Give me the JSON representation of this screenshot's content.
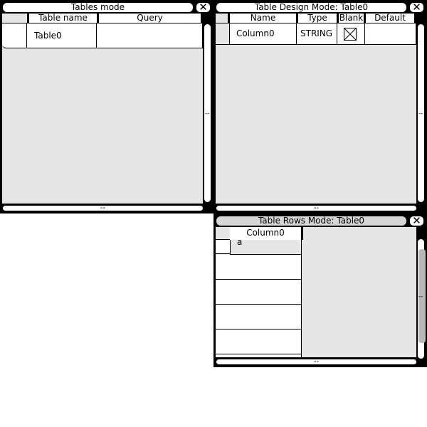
{
  "tables_window": {
    "title": "Tables mode",
    "close_label": "✕",
    "headers": {
      "name": "Table name",
      "query": "Query"
    },
    "rows": [
      {
        "name": "Table0",
        "query": ""
      }
    ],
    "hscroll_label": "--",
    "vscroll_grip": "--"
  },
  "design_window": {
    "title": "Table Design Mode: Table0",
    "close_label": "✕",
    "headers": {
      "name": "Name",
      "type": "Type",
      "blank": "Blank",
      "default": "Default"
    },
    "rows": [
      {
        "name": "Column0",
        "type": "STRING",
        "blank": true,
        "default": ""
      }
    ],
    "hscroll_label": "--",
    "vscroll_grip": "--"
  },
  "rows_window": {
    "title": "Table Rows Mode: Table0",
    "close_label": "✕",
    "headers": {
      "column0": "Column0"
    },
    "rows": [
      {
        "column0": "a"
      },
      {
        "column0": ""
      },
      {
        "column0": ""
      },
      {
        "column0": ""
      },
      {
        "column0": ""
      }
    ],
    "hscroll_label": "--",
    "vscroll_grip": "--"
  }
}
